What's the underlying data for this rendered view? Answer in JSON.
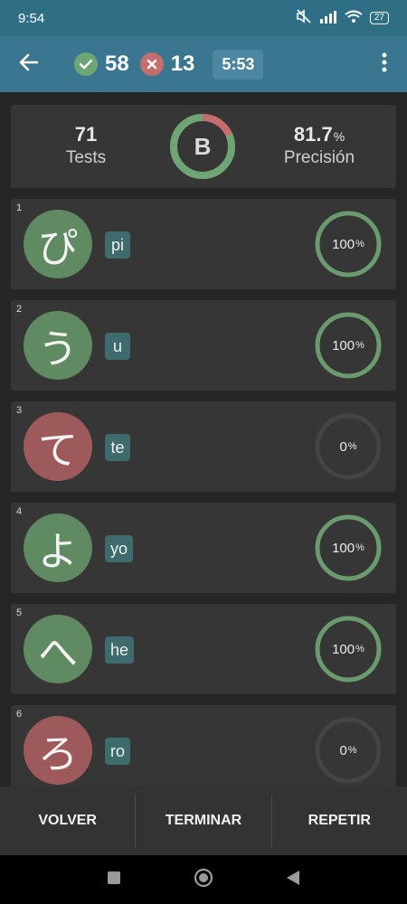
{
  "status": {
    "time": "9:54",
    "battery": "27"
  },
  "toolbar": {
    "correct": "58",
    "wrong": "13",
    "timer": "5:53"
  },
  "summary": {
    "tests_value": "71",
    "tests_label": "Tests",
    "grade": "B",
    "precision_value": "81.7",
    "precision_unit": "%",
    "precision_label": "Precisión",
    "precision_fraction": 0.817
  },
  "items": [
    {
      "index": "1",
      "kana": "ぴ",
      "romaji": "pi",
      "percent": "100",
      "unit": "%",
      "result": "correct"
    },
    {
      "index": "2",
      "kana": "う",
      "romaji": "u",
      "percent": "100",
      "unit": "%",
      "result": "correct"
    },
    {
      "index": "3",
      "kana": "て",
      "romaji": "te",
      "percent": "0",
      "unit": "%",
      "result": "wrong"
    },
    {
      "index": "4",
      "kana": "よ",
      "romaji": "yo",
      "percent": "100",
      "unit": "%",
      "result": "correct"
    },
    {
      "index": "5",
      "kana": "へ",
      "romaji": "he",
      "percent": "100",
      "unit": "%",
      "result": "correct"
    },
    {
      "index": "6",
      "kana": "ろ",
      "romaji": "ro",
      "percent": "0",
      "unit": "%",
      "result": "wrong"
    }
  ],
  "actions": {
    "back": "VOLVER",
    "finish": "TERMINAR",
    "repeat": "REPETIR"
  },
  "colors": {
    "header": "#3a7690",
    "correct": "#6ea574",
    "wrong": "#c56e6e",
    "card": "#363636",
    "background": "#262626"
  },
  "icons": {
    "back": "arrow-left-icon",
    "menu": "more-vert-icon",
    "correct": "check-circle-icon",
    "wrong": "x-circle-icon"
  }
}
